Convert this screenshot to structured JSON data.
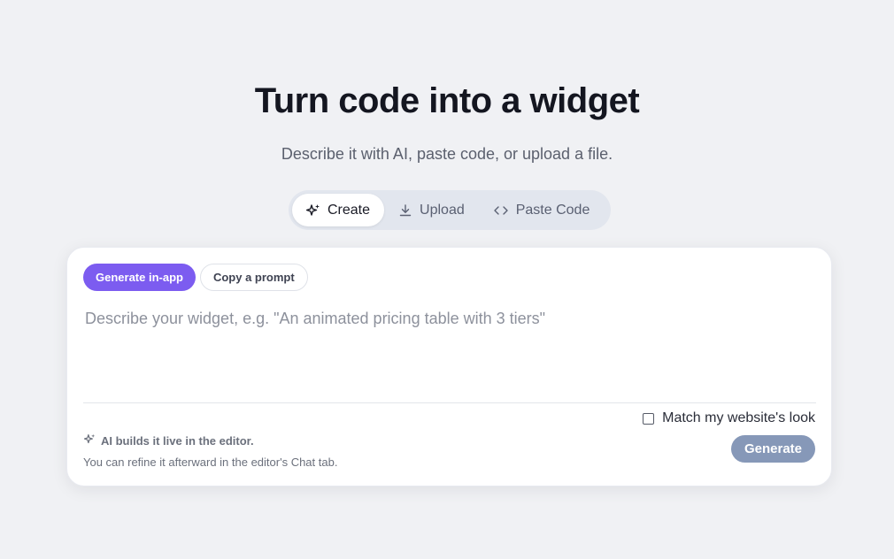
{
  "hero": {
    "title": "Turn code into a widget",
    "subtitle": "Describe it with AI, paste code, or upload a file."
  },
  "mode_tabs": [
    {
      "label": "Create",
      "icon": "sparkle-icon",
      "active": true
    },
    {
      "label": "Upload",
      "icon": "download-icon",
      "active": false
    },
    {
      "label": "Paste Code",
      "icon": "code-icon",
      "active": false
    }
  ],
  "card": {
    "pills": {
      "generate_in_app": "Generate in-app",
      "copy_prompt": "Copy a prompt"
    },
    "prompt_placeholder": "Describe your widget, e.g. \"An animated pricing table with 3 tiers\"",
    "prompt_value": "",
    "match_label": "Match my website's look",
    "match_checked": false,
    "ai_note": "AI builds it live in the editor.",
    "refine_note": "You can refine it afterward in the editor's Chat tab.",
    "generate_label": "Generate"
  },
  "colors": {
    "background": "#f0f1f4",
    "accent_purple": "#7c5cf0",
    "generate_disabled": "#8698b8"
  }
}
